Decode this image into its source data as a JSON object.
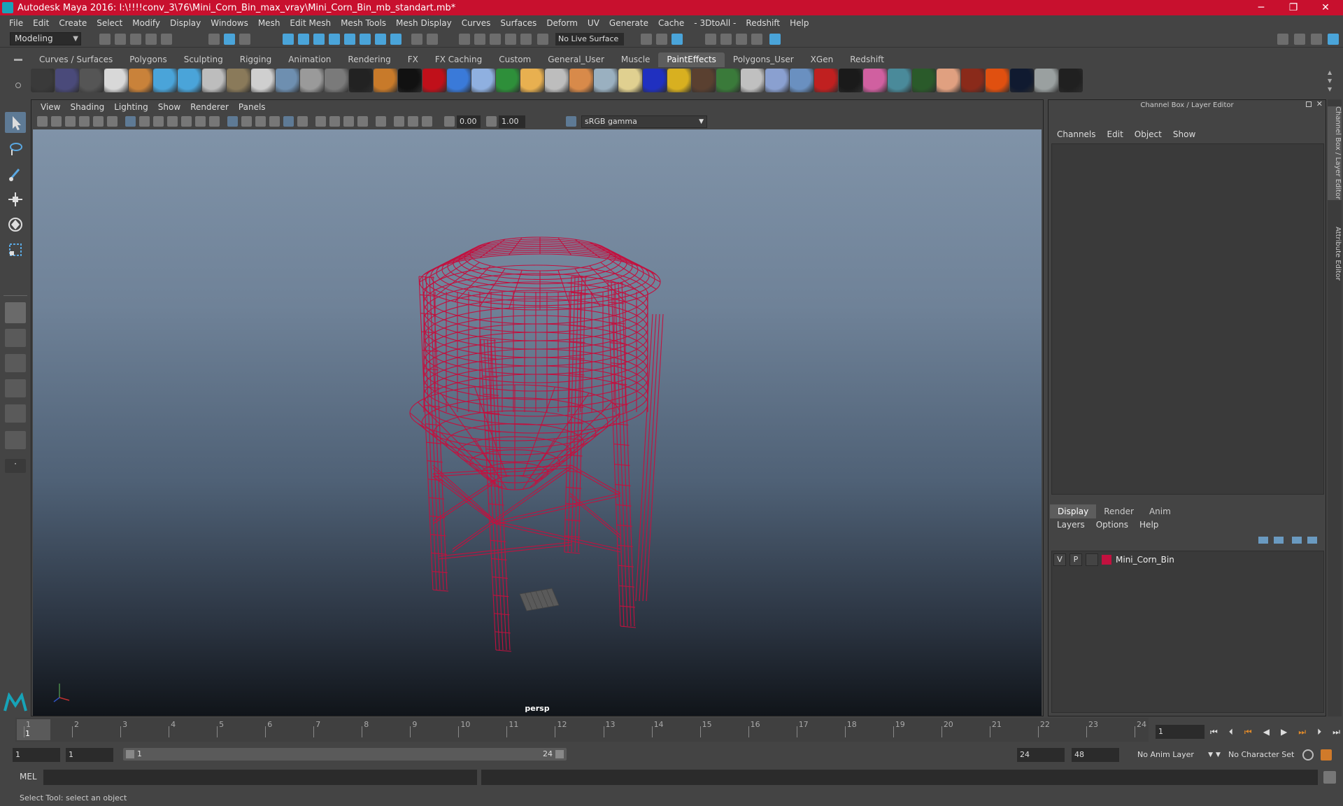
{
  "window": {
    "title": "Autodesk Maya 2016: I:\\!!!!conv_3\\76\\Mini_Corn_Bin_max_vray\\Mini_Corn_Bin_mb_standart.mb*",
    "minimize": "─",
    "maximize": "❐",
    "close": "✕"
  },
  "menus": [
    "File",
    "Edit",
    "Create",
    "Select",
    "Modify",
    "Display",
    "Windows",
    "Mesh",
    "Edit Mesh",
    "Mesh Tools",
    "Mesh Display",
    "Curves",
    "Surfaces",
    "Deform",
    "UV",
    "Generate",
    "Cache",
    "- 3DtoAll -",
    "Redshift",
    "Help"
  ],
  "status_line": {
    "mode": "Modeling",
    "live_surface": "No Live Surface"
  },
  "shelf": {
    "tabs": [
      "Curves / Surfaces",
      "Polygons",
      "Sculpting",
      "Rigging",
      "Animation",
      "Rendering",
      "FX",
      "FX Caching",
      "Custom",
      "General_User",
      "Muscle",
      "PaintEffects",
      "Polygons_User",
      "XGen",
      "Redshift"
    ],
    "active_tab": "PaintEffects",
    "icon_colors": [
      "#3a3a3a",
      "#4a4a7a",
      "#555",
      "#d8d8d8",
      "#c9823a",
      "#4aa4d9",
      "#4aa4d9",
      "#bdbdbd",
      "#8a7a5a",
      "#cfcfcf",
      "#6e8fb0",
      "#9a9a9a",
      "#7a7a7a",
      "#222",
      "#c87a2a",
      "#111",
      "#c0101a",
      "#3a7ad9",
      "#8fb0e0",
      "#2e8f3a",
      "#e8b050",
      "#bdbdbd",
      "#d88a4a",
      "#9ab0c0",
      "#e0d090",
      "#2030c0",
      "#d8b020",
      "#5a4030",
      "#3a7a3a",
      "#c0c0c0",
      "#8aa0d0",
      "#6a90c0",
      "#c02020",
      "#1a1a1a",
      "#d060a0",
      "#4a8a9a",
      "#2a5a2a",
      "#e0a080",
      "#8a2a1a",
      "#e05010",
      "#101a30",
      "#9aa0a0",
      "#202020"
    ]
  },
  "viewport": {
    "menus": [
      "View",
      "Shading",
      "Lighting",
      "Show",
      "Renderer",
      "Panels"
    ],
    "exposure": "0.00",
    "gamma": "1.00",
    "color_space": "sRGB gamma",
    "camera_label": "persp",
    "wire_color": "#c2113f"
  },
  "channel_box": {
    "title": "Channel Box / Layer Editor",
    "menus": [
      "Channels",
      "Edit",
      "Object",
      "Show"
    ]
  },
  "layer_editor": {
    "tabs": [
      "Display",
      "Render",
      "Anim"
    ],
    "active_tab": "Display",
    "menus": [
      "Layers",
      "Options",
      "Help"
    ],
    "layer": {
      "v": "V",
      "p": "P",
      "name": "Mini_Corn_Bin",
      "color": "#c2113f"
    }
  },
  "side_tabs": [
    "Channel Box / Layer Editor",
    "Attribute Editor"
  ],
  "time_slider": {
    "ticks": [
      "1",
      "2",
      "3",
      "4",
      "5",
      "6",
      "7",
      "8",
      "9",
      "10",
      "11",
      "12",
      "13",
      "14",
      "15",
      "16",
      "17",
      "18",
      "19",
      "20",
      "21",
      "22",
      "23",
      "24"
    ],
    "current_frame": "1",
    "current_frame_field": "1"
  },
  "range": {
    "start": "1",
    "playback_start": "1",
    "range_start_label": "1",
    "range_end_label": "24",
    "playback_end": "24",
    "end": "48",
    "anim_layer": "No Anim Layer",
    "character_set": "No Character Set"
  },
  "command_line": {
    "label": "MEL"
  },
  "status": {
    "help": "Select Tool: select an object"
  }
}
